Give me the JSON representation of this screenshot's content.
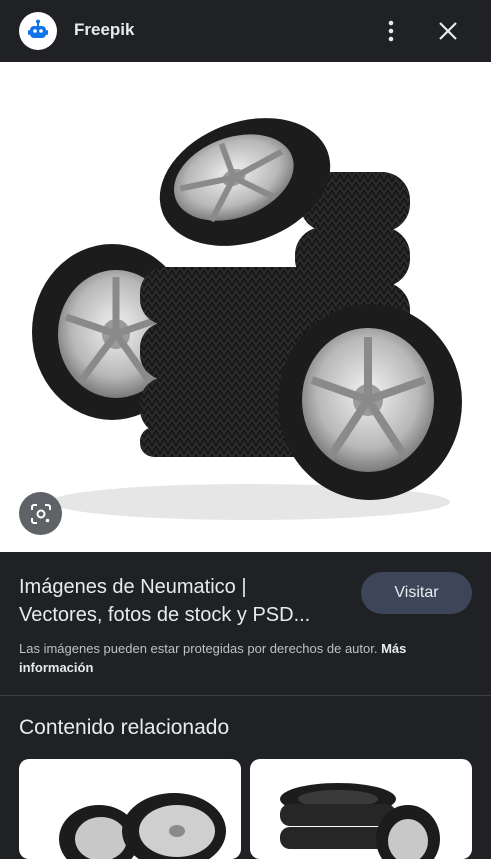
{
  "header": {
    "site_name": "Freepik",
    "logo_icon": "freepik-robot-icon",
    "more_icon": "more-vert-icon",
    "close_icon": "close-icon"
  },
  "main_image": {
    "subject": "stack of car tires with alloy wheels"
  },
  "lens_icon": "google-lens-icon",
  "result": {
    "title_line1": "Imágenes de Neumatico |",
    "title_line2": "Vectores, fotos de stock y PSD...",
    "visit_label": "Visitar",
    "copyright_text": "Las imágenes pueden estar protegidas por derechos de autor.",
    "more_info_label": "Más información"
  },
  "related": {
    "title": "Contenido relacionado",
    "items": [
      {
        "subject": "tires with alloy wheels"
      },
      {
        "subject": "stacked tires"
      }
    ]
  },
  "colors": {
    "background": "#202124",
    "button_bg": "#3c4658",
    "text": "#e8eaed",
    "brand_blue": "#1273eb"
  }
}
